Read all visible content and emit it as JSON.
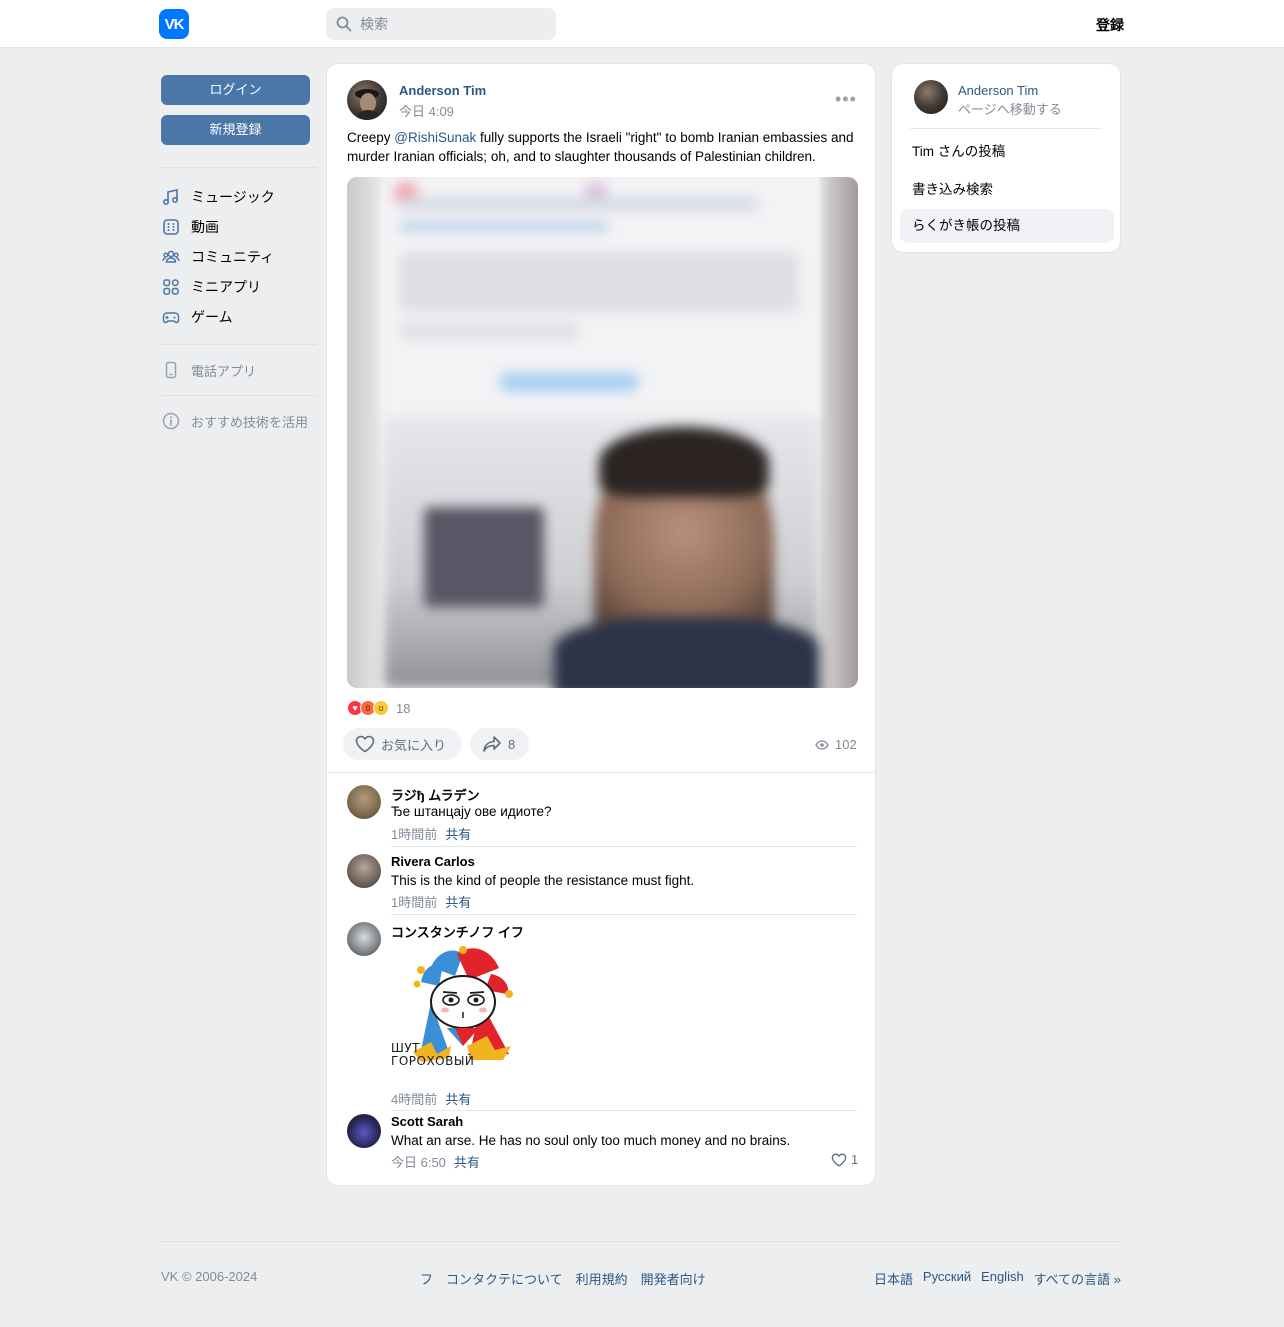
{
  "header": {
    "logo_text": "VK",
    "search_placeholder": "検索",
    "register_label": "登録"
  },
  "left_nav": {
    "login_label": "ログイン",
    "signup_label": "新規登録",
    "items": [
      {
        "label": "ミュージック",
        "icon": "music-icon"
      },
      {
        "label": "動画",
        "icon": "video-icon"
      },
      {
        "label": "コミュニティ",
        "icon": "community-icon"
      },
      {
        "label": "ミニアプリ",
        "icon": "mini-apps-icon"
      },
      {
        "label": "ゲーム",
        "icon": "gamepad-icon"
      }
    ],
    "phone_app_label": "電話アプリ",
    "recommend_label": "おすすめ技術を活用"
  },
  "post": {
    "author": "Anderson Tim",
    "time": "今日 4:09",
    "text_before": "Creepy ",
    "mention": "@RishiSunak",
    "text_after": " fully supports the Israeli \"right\" to bomb Iranian embassies and murder Iranian officials; oh, and to slaughter thousands of Palestinian children.",
    "reactions_count": "18",
    "like_label": "お気に入り",
    "share_count": "8",
    "views_count": "102"
  },
  "comments": [
    {
      "name": "ラジђ ムラデン",
      "text": "Ђе штанцају ове идиоте?",
      "time": "1時間前",
      "share": "共有"
    },
    {
      "name": "Rivera Carlos",
      "text": "This is the kind of people the resistance must fight.",
      "time": "1時間前",
      "share": "共有"
    },
    {
      "name": "コンスタンチノフ イフ",
      "sticker_text_1": "ШУТ",
      "sticker_text_2": "ГОРОХОВЫЙ",
      "time": "4時間前",
      "share": "共有"
    },
    {
      "name": "Scott Sarah",
      "text": "What an arse. He has no soul only too much money and no brains.",
      "time": "今日 6:50",
      "share": "共有",
      "likes": "1"
    }
  ],
  "right_panel": {
    "name": "Anderson Tim",
    "sub": "ページへ移動する",
    "items": [
      "Tim さんの投稿",
      "書き込み検索",
      "らくがき帳の投稿"
    ]
  },
  "footer": {
    "copyright": "VK © 2006-2024",
    "links": [
      "フ",
      "コンタクテについて",
      "利用規約",
      "開発者向け"
    ],
    "languages": [
      "日本語",
      "Русский",
      "English",
      "すべての言語 »"
    ]
  },
  "colors": {
    "accent": "#4a76a8",
    "link": "#2a5885",
    "brand": "#0077ff",
    "background": "#edeef0"
  }
}
